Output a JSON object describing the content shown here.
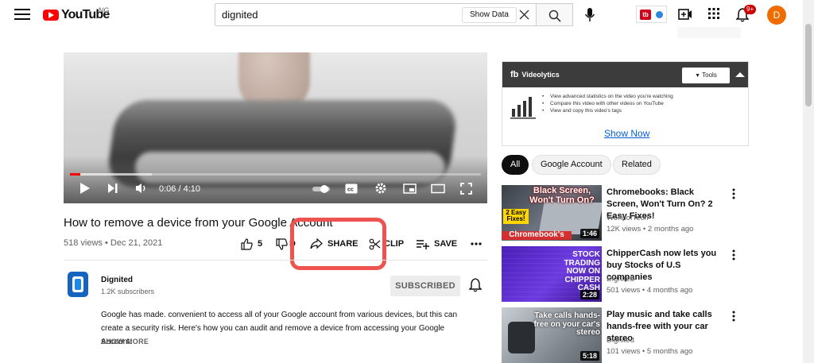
{
  "header": {
    "logo_text": "YouTube",
    "country_code": "NG",
    "search_value": "dignited",
    "show_data_label": "Show Data",
    "notification_count": "9+",
    "avatar_letter": "D",
    "extension_label": "tb"
  },
  "player": {
    "time_display": "0:06 / 4:10",
    "progress_fraction": 0.025,
    "buffered_fraction": 0.2
  },
  "video": {
    "title": "How to remove a device from your Google Account",
    "meta": "518 views • Dec 21, 2021",
    "actions": {
      "like_count": "5",
      "dislike_label": "D",
      "share_label": "SHARE",
      "clip_label": "CLIP",
      "save_label": "SAVE"
    }
  },
  "channel": {
    "name": "Dignited",
    "subscribers": "1.2K subscribers",
    "subscribe_label": "SUBSCRIBED",
    "description": "Google has made. convenient to access all of your Google account from various devices, but this can create a security risk. Here's how you can audit and remove a device from accessing your Google Account.",
    "show_more_label": "SHOW MORE"
  },
  "videolytics": {
    "logo_mark": "fb",
    "title": "Videolytics",
    "tools_label": "Tools",
    "features": [
      "View advanced statistics on the video you're watching",
      "Compare this video with other videos on YouTube",
      "View and copy this video's tags"
    ],
    "link_label": "Show Now"
  },
  "chips": [
    "All",
    "Google Account",
    "Related"
  ],
  "recommendations": [
    {
      "title": "Chromebooks: Black Screen, Won't Turn On? 2 Easy Fixes!",
      "channel": "WorldofTech",
      "meta": "12K views • 2 months ago",
      "duration": "1:46",
      "thumb_text_top": "Black Screen, Won't Turn On?",
      "thumb_badge": "2 Easy Fixes!",
      "thumb_text_bottom": "Chromebook's"
    },
    {
      "title": "ChipperCash now lets you buy Stocks of U.S companies",
      "channel": "Dignited",
      "meta": "501 views • 4 months ago",
      "duration": "2:28",
      "thumb_text": "STOCK TRADING NOW ON CHIPPER CASH"
    },
    {
      "title": "Play music and take calls hands-free with your car stereo",
      "channel": "Dignited",
      "meta": "101 views • 5 months ago",
      "duration": "5:18",
      "thumb_text": "Take calls hands-free on your car's stereo"
    }
  ],
  "colors": {
    "brand_red": "#ff0000",
    "highlight": "#ef5350",
    "link_blue": "#065fd4",
    "avatar": "#ef6c00"
  }
}
